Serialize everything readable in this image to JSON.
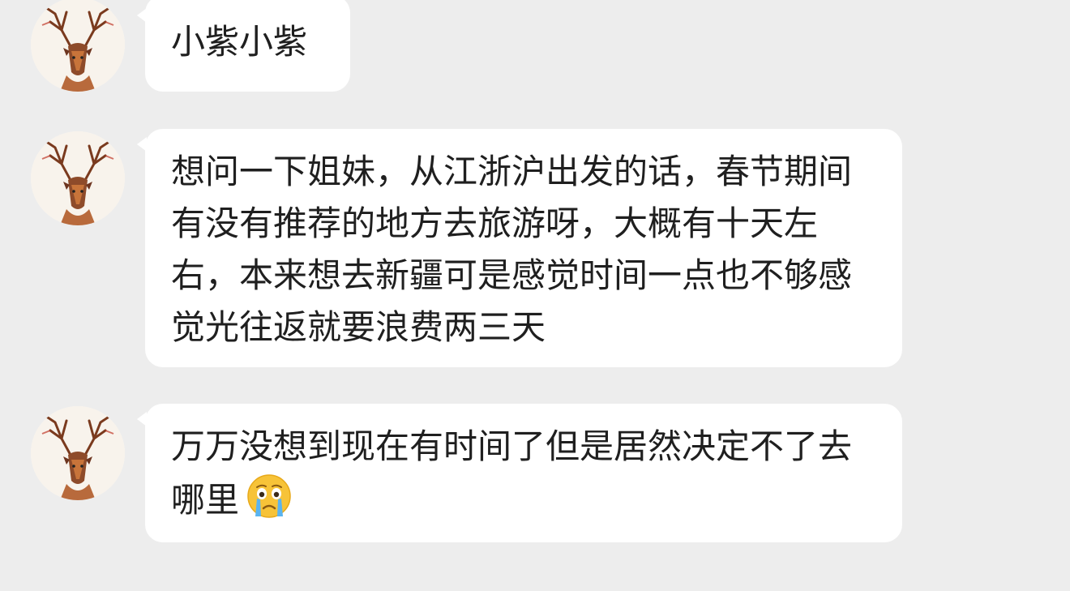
{
  "messages": [
    {
      "text": "小紫小紫",
      "avatar_icon": "deer-avatar-icon"
    },
    {
      "text": "想问一下姐妹，从江浙沪出发的话，春节期间有没有推荐的地方去旅游呀，大概有十天左右，本来想去新疆可是感觉时间一点也不够感觉光往返就要浪费两三天",
      "avatar_icon": "deer-avatar-icon"
    },
    {
      "text": "万万没想到现在有时间了但是居然决定不了去哪里",
      "avatar_icon": "deer-avatar-icon",
      "trailing_emoji": "crying-face-emoji"
    }
  ],
  "colors": {
    "background": "#ededed",
    "bubble": "#ffffff",
    "text": "#1f1f1f"
  }
}
